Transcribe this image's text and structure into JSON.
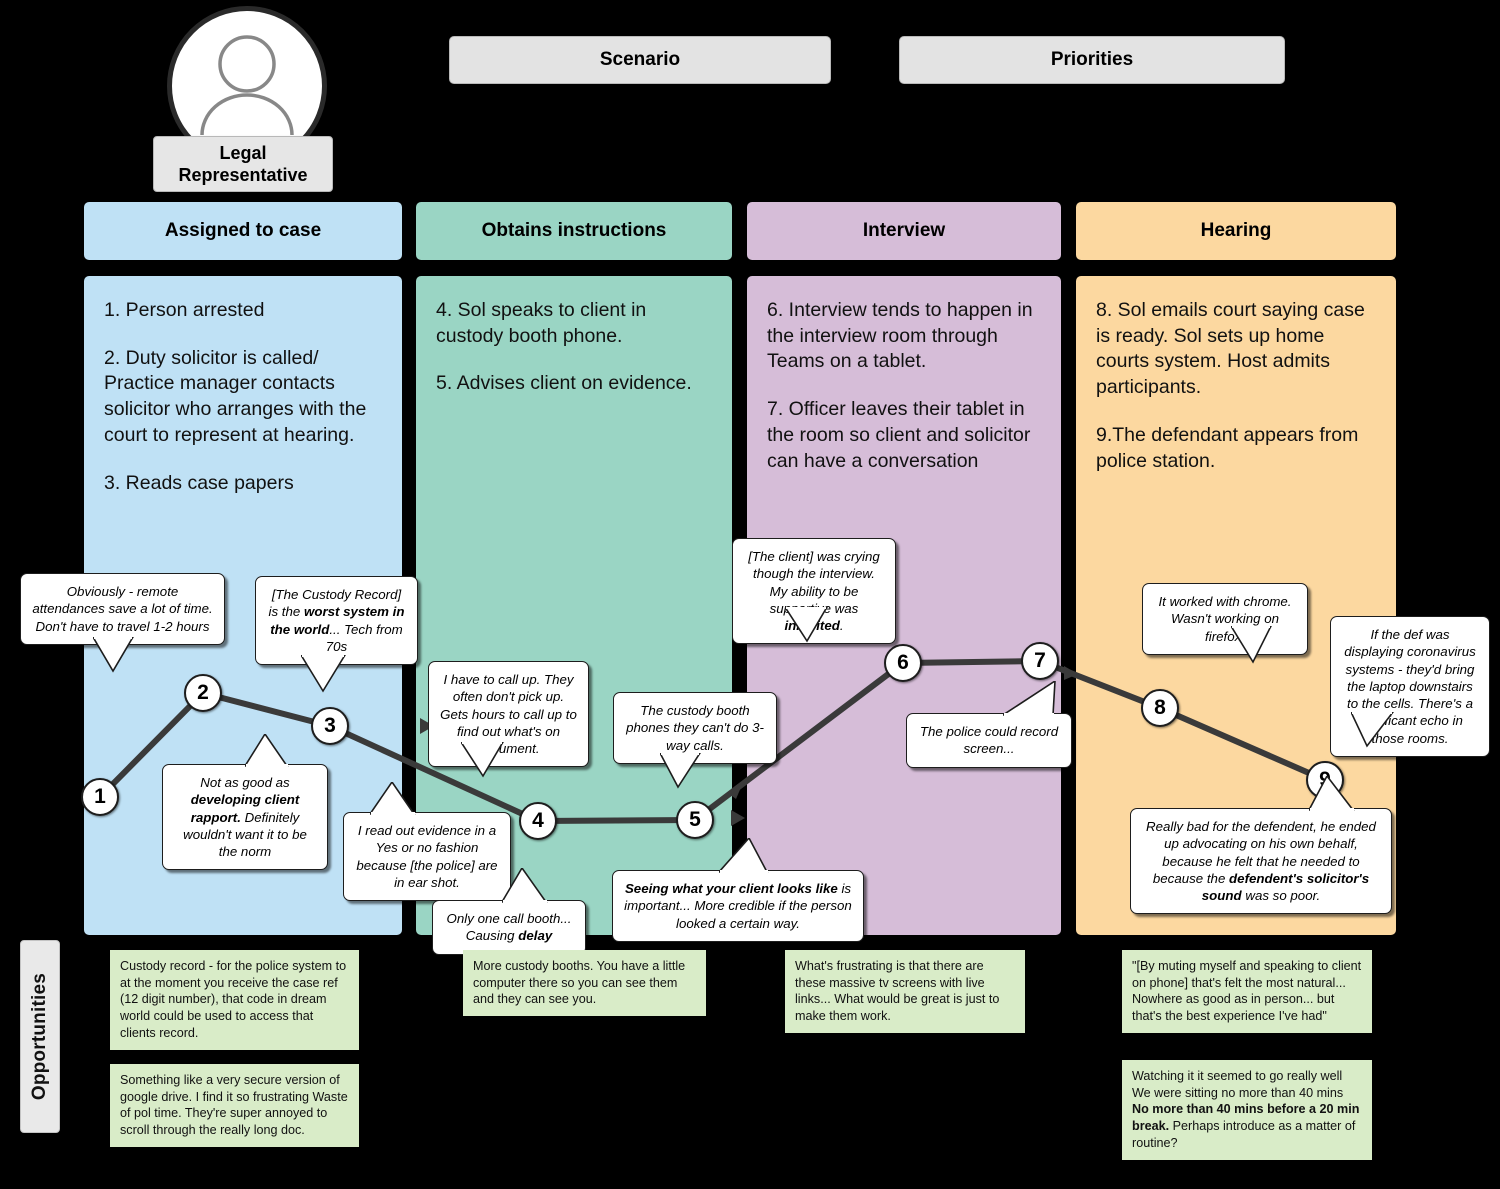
{
  "persona": {
    "label": "Legal Representative",
    "avatar_icon": "person-avatar-icon"
  },
  "top_tabs": [
    {
      "label": "Scenario"
    },
    {
      "label": "Priorities"
    }
  ],
  "stages": [
    {
      "title": "Assigned to case",
      "color": "#bfe1f5",
      "steps": [
        "1. Person arrested",
        "2. Duty solicitor is called/ Practice manager contacts solicitor who arranges with the court to represent at hearing.",
        "3. Reads case papers"
      ]
    },
    {
      "title": "Obtains instructions",
      "color": "#9ad5c4",
      "steps": [
        "4. Sol speaks to client in custody booth phone.",
        "5. Advises client on evidence."
      ]
    },
    {
      "title": "Interview",
      "color": "#d6bdd8",
      "steps": [
        "6. Interview tends to happen in the interview room through Teams on a tablet.",
        "7. Officer leaves their tablet in the room so client and solicitor can have a conversation"
      ]
    },
    {
      "title": "Hearing",
      "color": "#fcd8a0",
      "steps": [
        "8. Sol emails court saying case is ready. Sol sets up home courts system. Host admits participants.",
        "9.The defendant appears from police station."
      ]
    }
  ],
  "nodes": [
    {
      "label": "1"
    },
    {
      "label": "2"
    },
    {
      "label": "3"
    },
    {
      "label": "4"
    },
    {
      "label": "5"
    },
    {
      "label": "6"
    },
    {
      "label": "7"
    },
    {
      "label": "8"
    },
    {
      "label": "9"
    }
  ],
  "quotes": [
    {
      "id": "q1",
      "text": "Obviously - remote attendances save a lot of time. Don't have to travel 1-2 hours"
    },
    {
      "id": "q2",
      "pre": "[The Custody Record] is the ",
      "bold": "worst system in the world",
      "post": "... Tech from 70s"
    },
    {
      "id": "q3",
      "pre": "Not as good as ",
      "bold": "developing client rapport.",
      "post": " Definitely wouldn't want it to be the norm"
    },
    {
      "id": "q4",
      "text": "I have to call up. They often don't pick up. Gets hours to call up to find out what's on document."
    },
    {
      "id": "q5",
      "text": "I read out evidence in a Yes or no fashion because [the police]  are in ear shot."
    },
    {
      "id": "q6",
      "pre": "Only one call booth... Causing ",
      "bold": "delay",
      "post": ""
    },
    {
      "id": "q7",
      "text": "The custody booth phones they can't do 3-way calls."
    },
    {
      "id": "q8",
      "pre": "",
      "bold": "Seeing what your client looks like",
      "post": " is important... More credible if the person looked a certain way."
    },
    {
      "id": "q9",
      "pre": "[The client] was crying though the interview. My ability to be supportive was ",
      "bold": "inhibited",
      "post": "."
    },
    {
      "id": "q10",
      "text": "The police could record screen..."
    },
    {
      "id": "q11",
      "text": "It worked with chrome. Wasn't working on firefox."
    },
    {
      "id": "q12",
      "text": "If the def was displaying coronavirus systems - they'd bring the laptop downstairs to the cells. There's a significant echo in those rooms."
    },
    {
      "id": "q13",
      "pre": "Really bad for the defendent, he ended up advocating on his own behalf, because he felt that he needed to because the ",
      "bold": "defendent's solicitor's sound",
      "post": " was so poor."
    }
  ],
  "opportunities_label": "Opportunities",
  "opportunities": [
    {
      "id": "o1",
      "text": "Custody record - for the police system to at the moment you receive the case ref (12 digit number), that code in dream world could be used to access that clients record."
    },
    {
      "id": "o2",
      "text": "Something like a very secure version of google drive. I find it so frustrating Waste of pol time. They're super annoyed to scroll through the really long doc."
    },
    {
      "id": "o3",
      "text": "More custody booths. You have a little computer there so you can see them and they can see you."
    },
    {
      "id": "o4",
      "text": "What's frustrating is that there are these massive tv screens with live links... What would be great is just to make them work."
    },
    {
      "id": "o5",
      "text": "\"[By muting myself and speaking to client on phone] that's felt the most natural... Nowhere as good as in person... but that's the best experience I've had\""
    },
    {
      "id": "o6",
      "pre": "Watching it it seemed to go really well We were sitting no more than 40 mins ",
      "bold": "No more than 40 mins before a 20 min break.",
      "post": " Perhaps introduce as a matter of routine?"
    }
  ]
}
